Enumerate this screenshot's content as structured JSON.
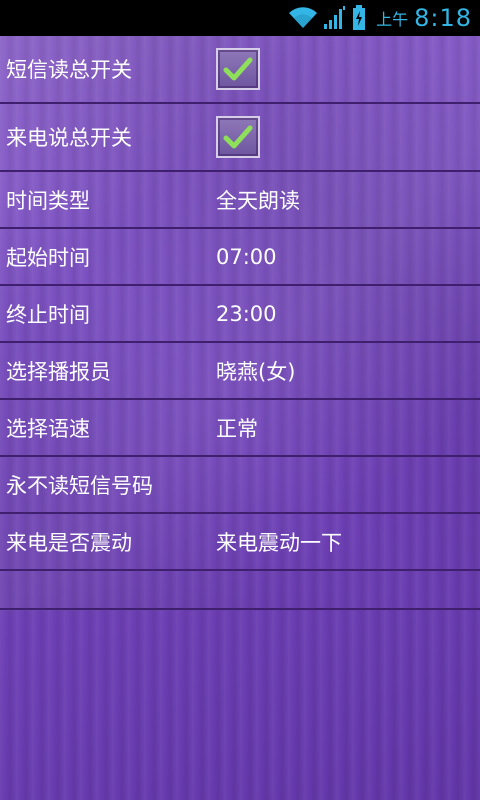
{
  "status_bar": {
    "time_prefix": "上午",
    "time": "8:18",
    "icons": [
      "wifi-icon",
      "signal-icon",
      "battery-charging-icon"
    ]
  },
  "settings": {
    "rows": [
      {
        "label": "短信读总开关",
        "type": "checkbox",
        "checked": true
      },
      {
        "label": "来电说总开关",
        "type": "checkbox",
        "checked": true
      },
      {
        "label": "时间类型",
        "value": "全天朗读"
      },
      {
        "label": "起始时间",
        "value": "07:00"
      },
      {
        "label": "终止时间",
        "value": "23:00"
      },
      {
        "label": "选择播报员",
        "value": "晓燕(女)"
      },
      {
        "label": "选择语速",
        "value": "正常"
      },
      {
        "label": "永不读短信号码",
        "value": ""
      },
      {
        "label": "来电是否震动",
        "value": "来电震动一下"
      }
    ]
  },
  "colors": {
    "background": "#7a4fc0",
    "divider": "#3f1f6e",
    "status_accent": "#33b5e5",
    "check_mark": "#8ee05a"
  }
}
